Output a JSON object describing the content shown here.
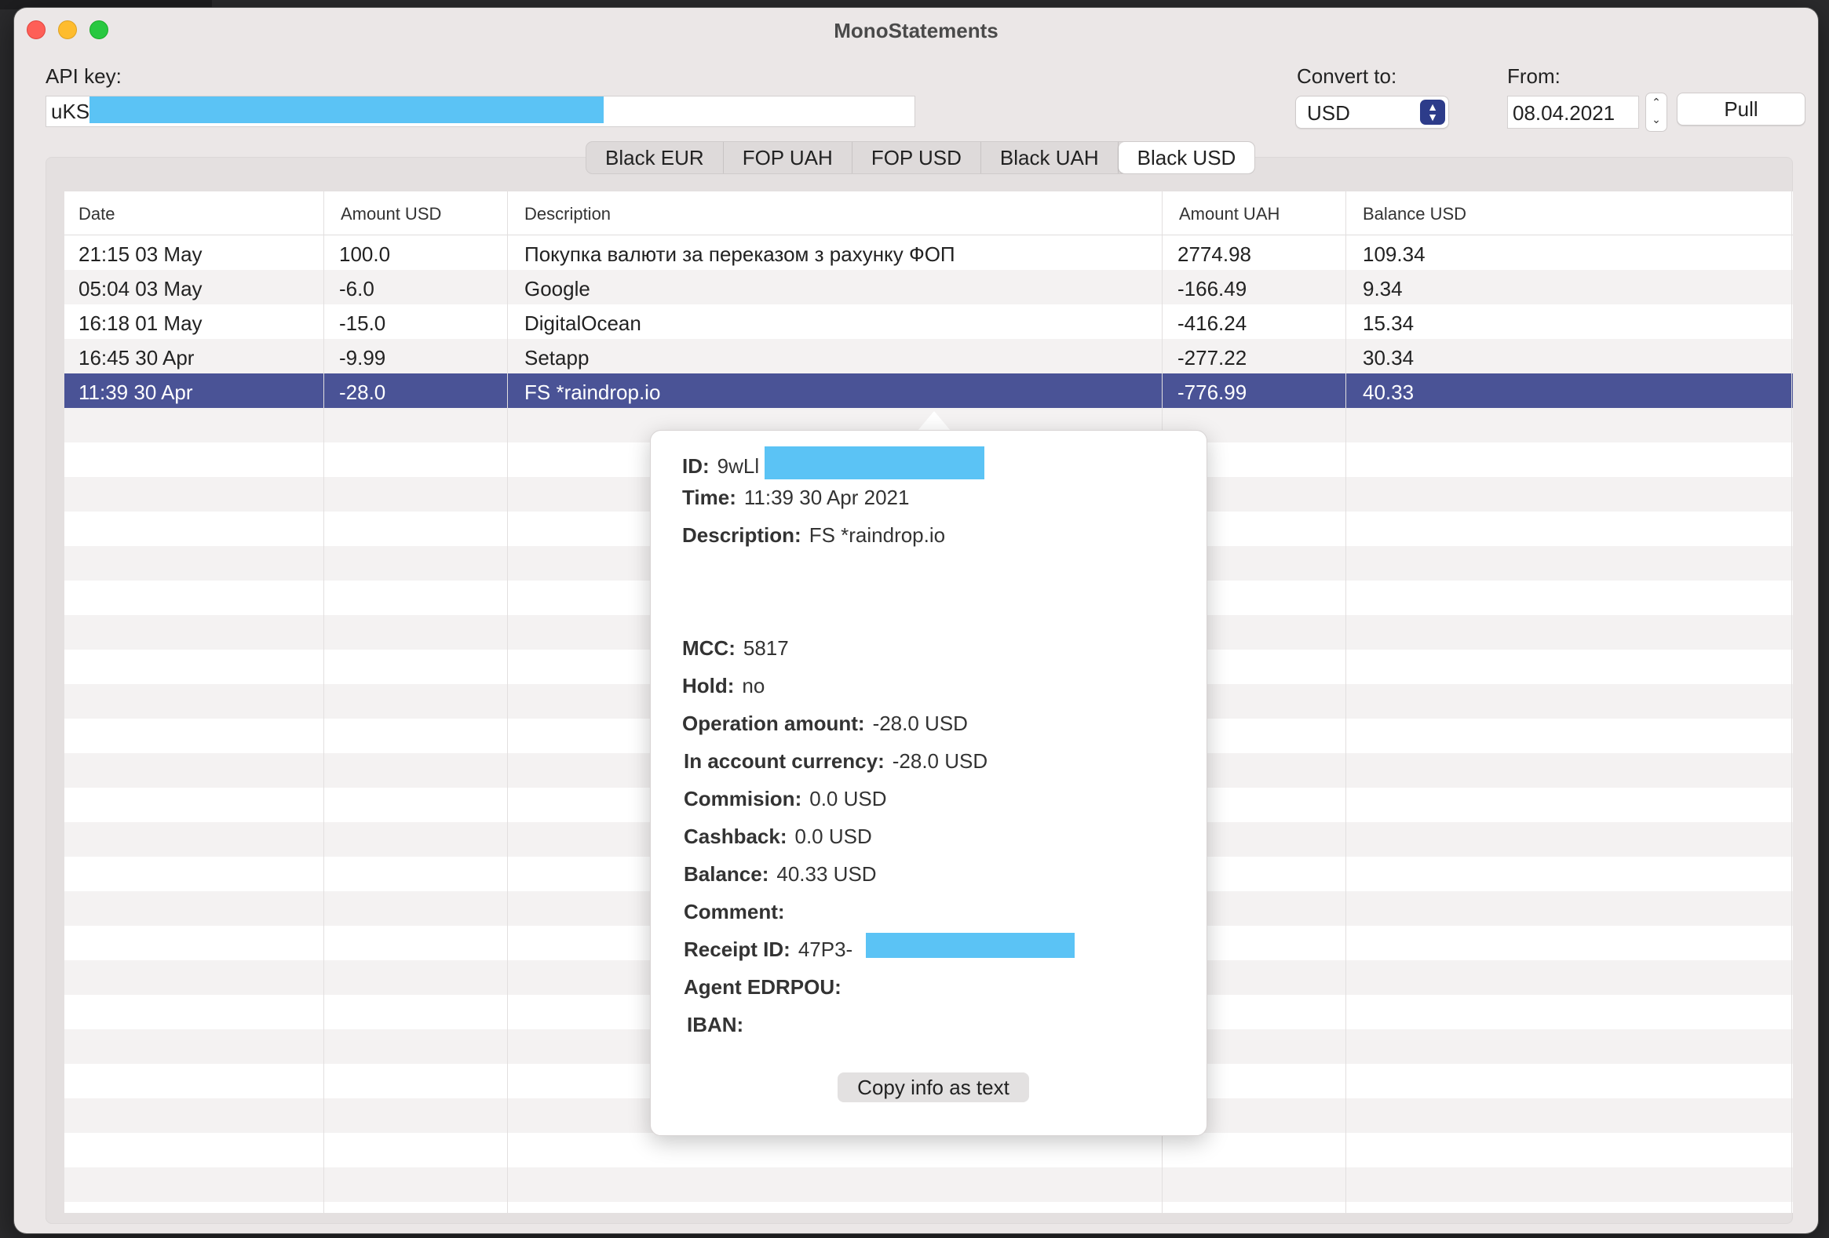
{
  "window": {
    "title": "MonoStatements"
  },
  "controls": {
    "api_key_label": "API key:",
    "api_key_value": "uKS",
    "convert_label": "Convert to:",
    "convert_value": "USD",
    "from_label": "From:",
    "from_value": "08.04.2021",
    "pull_label": "Pull"
  },
  "tabs": [
    "Black EUR",
    "FOP UAH",
    "FOP USD",
    "Black UAH",
    "Black USD"
  ],
  "active_tab": "Black USD",
  "table": {
    "headers": [
      "Date",
      "Amount USD",
      "Description",
      "Amount UAH",
      "Balance USD"
    ],
    "rows": [
      [
        "21:15 03 May",
        "100.0",
        "Покупка валюти за переказом з рахунку ФОП",
        "2774.98",
        "109.34"
      ],
      [
        "05:04 03 May",
        "-6.0",
        "Google",
        "-166.49",
        "9.34"
      ],
      [
        "16:18 01 May",
        "-15.0",
        "DigitalOcean",
        "-416.24",
        "15.34"
      ],
      [
        "16:45 30 Apr",
        "-9.99",
        "Setapp",
        "-277.22",
        "30.34"
      ],
      [
        "11:39 30 Apr",
        "-28.0",
        "FS *raindrop.io",
        "-776.99",
        "40.33"
      ]
    ],
    "selected_row": 4
  },
  "popover": {
    "id_label": "ID:",
    "id_value": "9wLl",
    "time_label": "Time:",
    "time_value": "11:39 30 Apr 2021",
    "desc_label": "Description:",
    "desc_value": "FS *raindrop.io",
    "mcc_label": "MCC:",
    "mcc_value": "5817",
    "hold_label": "Hold:",
    "hold_value": "no",
    "op_label": "Operation amount:",
    "op_value": "-28.0 USD",
    "acc_label": "In account currency:",
    "acc_value": "-28.0 USD",
    "comm_label": "Commision:",
    "comm_value": "0.0 USD",
    "cash_label": "Cashback:",
    "cash_value": "0.0 USD",
    "bal_label": "Balance:",
    "bal_value": "40.33 USD",
    "comment_label": "Comment:",
    "comment_value": "",
    "receipt_label": "Receipt ID:",
    "receipt_value": "47P3-",
    "agent_label": "Agent EDRPOU:",
    "agent_value": "",
    "iban_label": "IBAN:",
    "iban_value": "",
    "copy_label": "Copy info as text"
  },
  "colors": {
    "selection": "#4a5396",
    "redaction": "#5bc3f5",
    "accent": "#2d3c8a"
  }
}
